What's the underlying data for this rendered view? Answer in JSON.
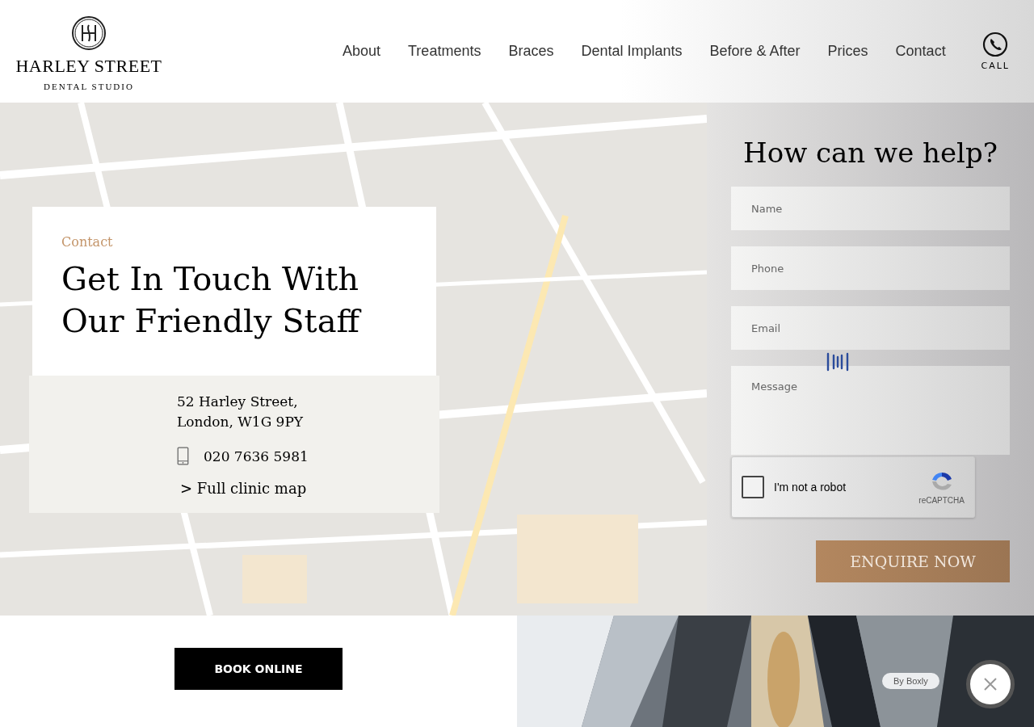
{
  "logo": {
    "name": "HARLEY STREET",
    "subtitle": "DENTAL STUDIO"
  },
  "nav": [
    {
      "label": "About"
    },
    {
      "label": "Treatments"
    },
    {
      "label": "Braces"
    },
    {
      "label": "Dental Implants"
    },
    {
      "label": "Before & After"
    },
    {
      "label": "Prices"
    },
    {
      "label": "Contact"
    }
  ],
  "call": {
    "label": "CALL"
  },
  "contact_card": {
    "eyebrow": "Contact",
    "heading": "Get In Touch With Our Friendly Staff",
    "address_lines": [
      "52 Harley Street,",
      "London, W1G 9PY"
    ],
    "phone": "020 7636 5981",
    "map_link": "> Full clinic map"
  },
  "form": {
    "title": "How can we help?",
    "fields": [
      {
        "placeholder": "Name",
        "kind": "input"
      },
      {
        "placeholder": "Phone",
        "kind": "input"
      },
      {
        "placeholder": "Email",
        "kind": "input"
      },
      {
        "placeholder": "Message",
        "kind": "textarea"
      }
    ],
    "captcha": {
      "label": "I'm not a robot",
      "checked": false,
      "brand": "reCAPTCHA"
    },
    "submit": "ENQUIRE NOW"
  },
  "book_button": "BOOK ONLINE",
  "widget": {
    "badge": "By Boxly"
  }
}
